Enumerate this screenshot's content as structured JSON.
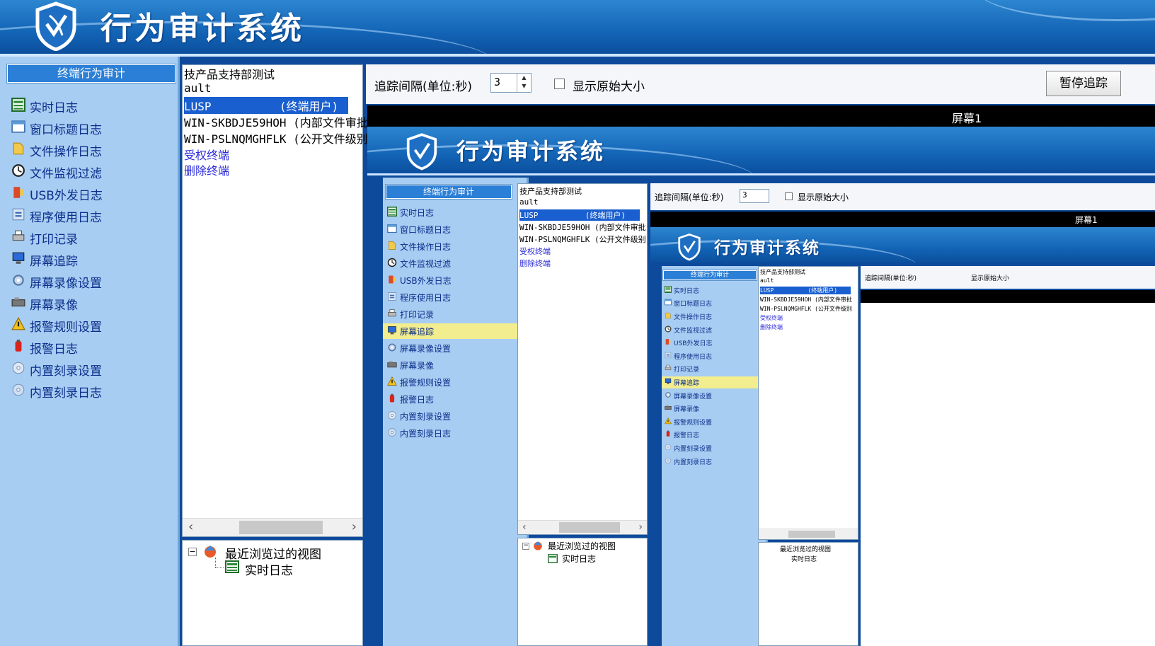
{
  "app": {
    "title": "行为审计系统",
    "colors": {
      "header": "#1364b6",
      "nav_bg": "#a8cdf2",
      "nav_text": "#0b2f8c",
      "selection": "#1a5fd0",
      "highlight": "#f2ed8e"
    }
  },
  "nav": {
    "header": "终端行为审计",
    "items": [
      {
        "label": "实时日志",
        "icon": "realtime-log-icon"
      },
      {
        "label": "窗口标题日志",
        "icon": "window-title-icon"
      },
      {
        "label": "文件操作日志",
        "icon": "file-op-icon"
      },
      {
        "label": "文件监视过滤",
        "icon": "file-monitor-icon"
      },
      {
        "label": "USB外发日志",
        "icon": "usb-icon"
      },
      {
        "label": "程序使用日志",
        "icon": "program-icon"
      },
      {
        "label": "打印记录",
        "icon": "printer-icon"
      },
      {
        "label": "屏幕追踪",
        "icon": "monitor-icon"
      },
      {
        "label": "屏幕录像设置",
        "icon": "gear-icon"
      },
      {
        "label": "屏幕录像",
        "icon": "camera-icon"
      },
      {
        "label": "报警规则设置",
        "icon": "warning-icon"
      },
      {
        "label": "报警日志",
        "icon": "alarm-icon"
      },
      {
        "label": "内置刻录设置",
        "icon": "disc-icon"
      },
      {
        "label": "内置刻录日志",
        "icon": "disc-log-icon"
      }
    ]
  },
  "terminals": {
    "lines": [
      {
        "text": "技产品支持部测试",
        "type": "normal"
      },
      {
        "text": "ault",
        "type": "normal"
      },
      {
        "text": "LUSP          (终端用户)",
        "type": "selected"
      },
      {
        "text": "WIN-SKBDJE59HOH (内部文件审批",
        "type": "normal"
      },
      {
        "text": "WIN-PSLNQMGHFLK (公开文件级别",
        "type": "normal"
      },
      {
        "text": "受权终端",
        "type": "link"
      },
      {
        "text": "删除终端",
        "type": "link"
      }
    ]
  },
  "tree": {
    "root": "最近浏览过的视图",
    "child": "实时日志"
  },
  "toolbar": {
    "interval_label": "追踪间隔(单位:秒)",
    "interval_value": "3",
    "show_original_label": "显示原始大小",
    "pause_button": "暂停追踪"
  },
  "screen": {
    "label": "屏幕1"
  }
}
